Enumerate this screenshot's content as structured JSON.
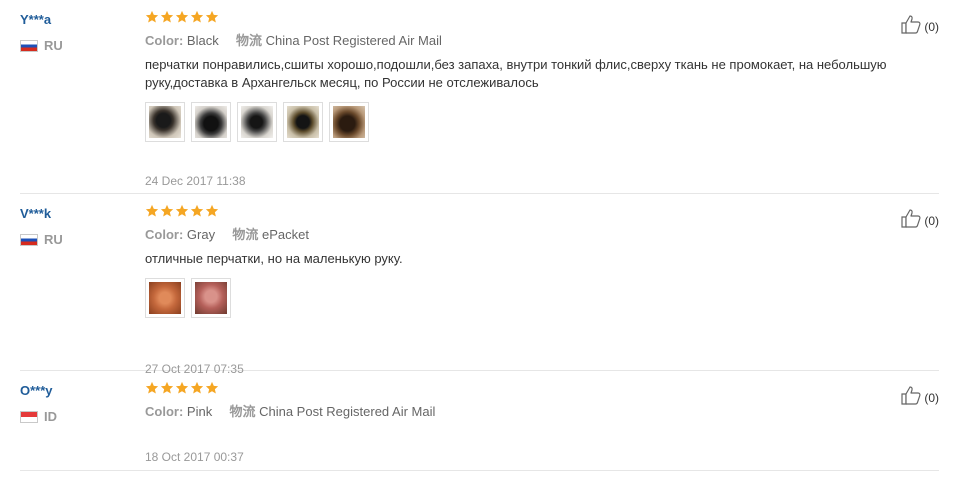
{
  "labels": {
    "color_label": "Color:",
    "shipping_label": "物流"
  },
  "reviews": [
    {
      "user": "Y***a",
      "country": "RU",
      "stars": 5,
      "color": "Black",
      "shipping": "China Post Registered Air Mail",
      "text": "перчатки понравились,сшиты хорошо,подошли,без запаха, внутри тонкий флис,сверху ткань не промокает, на небольшую руку,доставка в Архангельск месяц, по России не отслеживалось",
      "photos": [
        "glove-photo",
        "glove-photo",
        "glove-photo",
        "glove-photo",
        "glove-photo"
      ],
      "date": "24 Dec 2017 11:38",
      "helpful": "(0)"
    },
    {
      "user": "V***k",
      "country": "RU",
      "stars": 5,
      "color": "Gray",
      "shipping": "ePacket",
      "text": "отличные перчатки, но на маленькую руку.",
      "photos": [
        "glove-photo",
        "glove-photo"
      ],
      "date": "27 Oct 2017 07:35",
      "helpful": "(0)"
    },
    {
      "user": "O***y",
      "country": "ID",
      "stars": 5,
      "color": "Pink",
      "shipping": "China Post Registered Air Mail",
      "text": "",
      "photos": [],
      "date": "18 Oct 2017 00:37",
      "helpful": "(0)"
    }
  ],
  "colors": {
    "star": "#f5a623",
    "username": "#1f5c99",
    "muted": "#999999",
    "divider": "#e6e6e6"
  }
}
